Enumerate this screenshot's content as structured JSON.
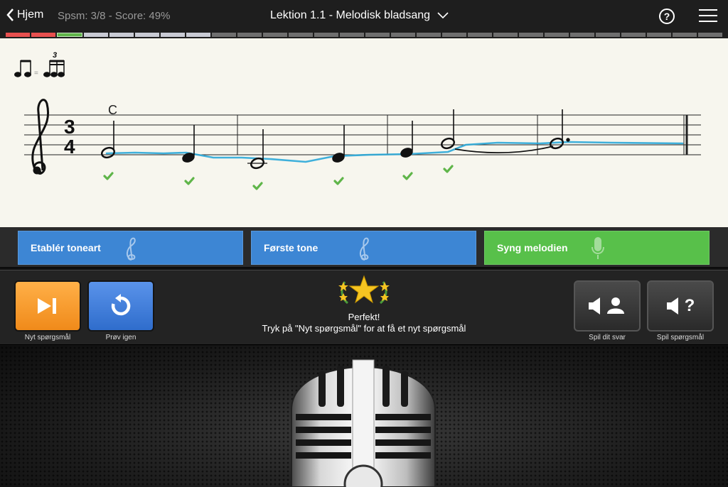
{
  "nav": {
    "back_label": "Hjem"
  },
  "header": {
    "stats": "Spsm: 3/8 - Score: 49%",
    "title": "Lektion 1.1 - Melodisk bladsang"
  },
  "progress": {
    "segments": [
      "bad",
      "bad",
      "good",
      "pending",
      "pending",
      "pending",
      "pending",
      "pending",
      "todo",
      "todo",
      "todo",
      "todo",
      "todo",
      "todo",
      "todo",
      "todo",
      "todo",
      "todo",
      "todo",
      "todo",
      "todo",
      "todo",
      "todo",
      "todo",
      "todo",
      "todo",
      "todo",
      "todo"
    ]
  },
  "score": {
    "chord_label": "C",
    "time_signature_top": "3",
    "time_signature_bottom": "4",
    "tuplet_number": "3",
    "clef": "treble",
    "checks_count": 6,
    "colors": {
      "pitch_trace": "#2aa9d8",
      "check": "#5fb549"
    }
  },
  "steps": [
    {
      "label": "Etablér toneart",
      "state": "blue",
      "icon": "treble-clef-icon"
    },
    {
      "label": "Første tone",
      "state": "blue",
      "icon": "treble-clef-icon"
    },
    {
      "label": "Syng melodien",
      "state": "green",
      "icon": "microphone-icon"
    }
  ],
  "controls": {
    "next_label": "Nyt spørgsmål",
    "retry_label": "Prøv igen",
    "play_answer_label": "Spil dit svar",
    "play_question_label": "Spil spørgsmål",
    "question_mark": "?"
  },
  "feedback": {
    "title": "Perfekt!",
    "message": "Tryk på \"Nyt spørgsmål\" for at få et nyt spørgsmål"
  },
  "colors": {
    "accent_blue": "#3d86d4",
    "accent_green": "#58c04a",
    "accent_orange": "#f59a2b",
    "error_red": "#e8504f"
  }
}
